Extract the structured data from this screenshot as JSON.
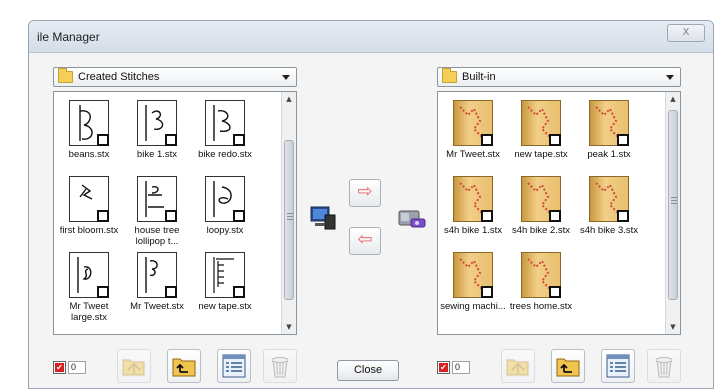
{
  "window": {
    "title": "ile Manager",
    "close_glyph": "X"
  },
  "left": {
    "dropdown_label": "Created Stitches",
    "files": [
      {
        "name": "beans.stx"
      },
      {
        "name": "bike 1.stx"
      },
      {
        "name": "bike redo.stx"
      },
      {
        "name": "first bloom.stx"
      },
      {
        "name": "house tree lollipop t..."
      },
      {
        "name": "loopy.stx"
      },
      {
        "name": "Mr Tweet large.stx"
      },
      {
        "name": "Mr Tweet.stx"
      },
      {
        "name": "new tape.stx"
      }
    ],
    "count": "0"
  },
  "right": {
    "dropdown_label": "Built-in",
    "files": [
      {
        "name": "Mr Tweet.stx"
      },
      {
        "name": "new tape.stx"
      },
      {
        "name": "peak 1.stx"
      },
      {
        "name": "s4h bike 1.stx"
      },
      {
        "name": "s4h bike 2.stx"
      },
      {
        "name": "s4h bike 3.stx"
      },
      {
        "name": "sewing machi..."
      },
      {
        "name": "trees home.stx"
      }
    ],
    "count": "0"
  },
  "transfer": {
    "to_right_glyph": "⇨",
    "to_left_glyph": "⇦"
  },
  "footer": {
    "close_label": "Close"
  },
  "icons": {
    "check": "✔"
  },
  "colors": {
    "accent_arrow": "#e46b6b",
    "folder_yellow": "#f3cf5a",
    "thumb_gold": "#e9be6e"
  }
}
